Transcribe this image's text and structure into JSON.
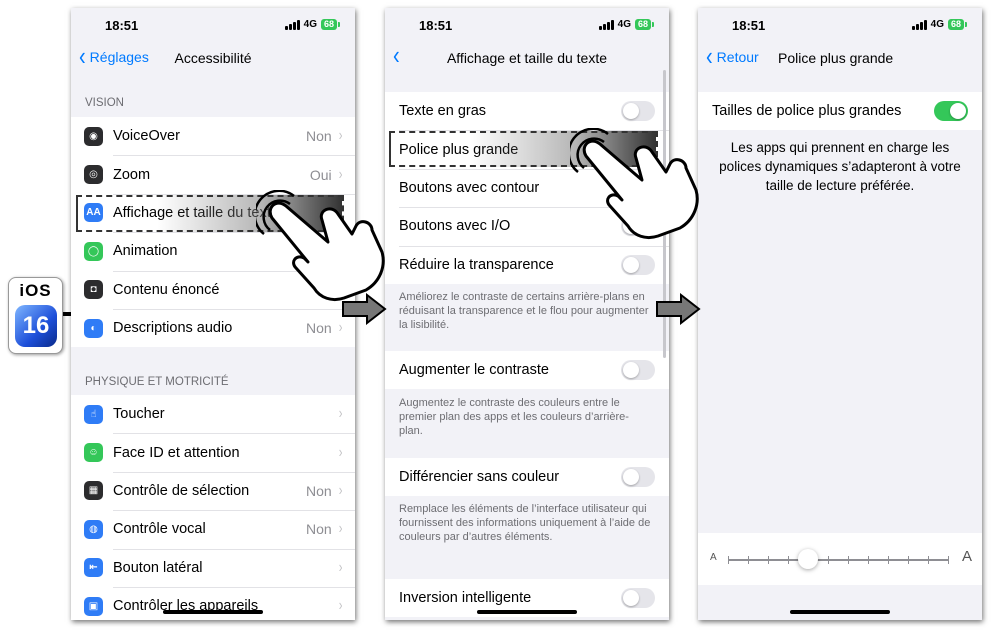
{
  "badge": {
    "os": "iOS",
    "version": "16"
  },
  "phone1": {
    "status": {
      "time": "18:51",
      "network": "4G",
      "battery": "68"
    },
    "nav": {
      "back": "Réglages",
      "title": "Accessibilité"
    },
    "sections": [
      {
        "header": "VISION",
        "items": [
          {
            "label": "VoiceOver",
            "value": "Non",
            "icon_color": "#2c2c2e",
            "icon": "voiceover-icon"
          },
          {
            "label": "Zoom",
            "value": "Oui",
            "icon_color": "#2c2c2e",
            "icon": "zoom-icon"
          },
          {
            "label": "Affichage et taille du texte",
            "value": "",
            "icon_color": "#2f7cf6",
            "icon": "text-size-icon",
            "glyph": "AA"
          },
          {
            "label": "Animation",
            "value": "",
            "icon_color": "#34c759",
            "icon": "motion-icon"
          },
          {
            "label": "Contenu énoncé",
            "value": "",
            "icon_color": "#2c2c2e",
            "icon": "spoken-content-icon"
          },
          {
            "label": "Descriptions audio",
            "value": "Non",
            "icon_color": "#2f7cf6",
            "icon": "audio-descriptions-icon"
          }
        ]
      },
      {
        "header": "PHYSIQUE ET MOTRICITÉ",
        "items": [
          {
            "label": "Toucher",
            "value": "",
            "icon_color": "#2f7cf6",
            "icon": "touch-icon"
          },
          {
            "label": "Face ID et attention",
            "value": "",
            "icon_color": "#34c759",
            "icon": "face-id-icon"
          },
          {
            "label": "Contrôle de sélection",
            "value": "Non",
            "icon_color": "#2c2c2e",
            "icon": "switch-control-icon"
          },
          {
            "label": "Contrôle vocal",
            "value": "Non",
            "icon_color": "#2f7cf6",
            "icon": "voice-control-icon"
          },
          {
            "label": "Bouton latéral",
            "value": "",
            "icon_color": "#2f7cf6",
            "icon": "side-button-icon"
          },
          {
            "label": "Contrôler les appareils",
            "value": "",
            "icon_color": "#2f7cf6",
            "icon": "control-devices-icon"
          }
        ]
      }
    ]
  },
  "phone2": {
    "status": {
      "time": "18:51",
      "network": "4G",
      "battery": "68"
    },
    "nav": {
      "title": "Affichage et taille du texte"
    },
    "groups": [
      {
        "items": [
          {
            "label": "Texte en gras",
            "toggle": "off"
          },
          {
            "label": "Police plus grande",
            "toggle": "none"
          },
          {
            "label": "Boutons avec contour",
            "toggle": "none"
          },
          {
            "label": "Boutons avec I/O",
            "toggle": "off"
          },
          {
            "label": "Réduire la transparence",
            "toggle": "off"
          }
        ],
        "footer": "Améliorez le contraste de certains arrière-plans en réduisant la transparence et le flou pour augmenter la lisibilité."
      },
      {
        "items": [
          {
            "label": "Augmenter le contraste",
            "toggle": "off"
          }
        ],
        "footer": "Augmentez le contraste des couleurs entre le premier plan des apps et les couleurs d’arrière-plan."
      },
      {
        "items": [
          {
            "label": "Différencier sans couleur",
            "toggle": "off"
          }
        ],
        "footer": "Remplace les éléments de l’interface utilisateur qui fournissent des informations uniquement à l’aide de couleurs par d’autres éléments."
      },
      {
        "items": [
          {
            "label": "Inversion intelligente",
            "toggle": "off"
          }
        ],
        "footer": ""
      }
    ]
  },
  "phone3": {
    "status": {
      "time": "18:51",
      "network": "4G",
      "battery": "68"
    },
    "nav": {
      "back": "Retour",
      "title": "Police plus grande"
    },
    "switch_label": "Tailles de police plus grandes",
    "switch_state": "on",
    "description": "Les apps qui prennent en charge les polices dynamiques s’adapteront à votre taille de lecture préférée.",
    "slider": {
      "min_label": "A",
      "max_label": "A",
      "steps": 12,
      "value_step": 4
    }
  }
}
